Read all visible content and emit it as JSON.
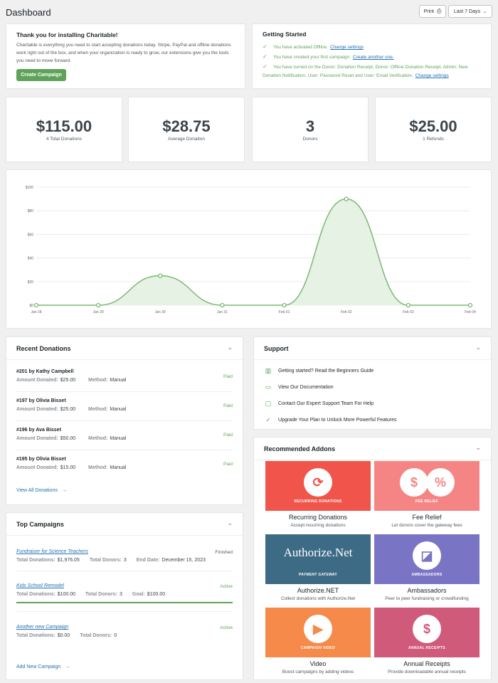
{
  "header": {
    "title": "Dashboard",
    "print_label": "Print",
    "date_range": "Last 7 Days"
  },
  "welcome": {
    "title": "Thank you for installing Charitable!",
    "body": "Charitable is everything you need to start accepting donations today. Stripe, PayPal and offline donations work right out of the box, and when your organization is ready to grow, our extensions give you the tools you need to move forward.",
    "button": "Create Campaign"
  },
  "getting_started": {
    "title": "Getting Started",
    "items": [
      {
        "text": "You have activated Offline.",
        "link": "Change settings"
      },
      {
        "text": "You have created your first campaign.",
        "link": "Create another one."
      },
      {
        "text": "You have turned on the Donor: Donation Receipt, Donor: Offline Donation Receipt, Admin: New Donation Notification, User: Password Reset and User: Email Verification.",
        "link": "Change settings"
      }
    ]
  },
  "stats": [
    {
      "value": "$115.00",
      "label": "4 Total Donations"
    },
    {
      "value": "$28.75",
      "label": "Average Donation"
    },
    {
      "value": "3",
      "label": "Donors"
    },
    {
      "value": "$25.00",
      "label": "1 Refunds"
    }
  ],
  "chart_data": {
    "type": "area",
    "x": [
      "Jan 28",
      "Jan 29",
      "Jan 30",
      "Jan 31",
      "Feb 01",
      "Feb 02",
      "Feb 03",
      "Feb 04"
    ],
    "series": [
      {
        "values": [
          0,
          0,
          25,
          0,
          0,
          90,
          0,
          0
        ]
      }
    ],
    "yticks": [
      "$0",
      "$20",
      "$40",
      "$60",
      "$80",
      "$100"
    ],
    "ylim": [
      0,
      100
    ],
    "grid": true,
    "colors": {
      "line": "#7bb874",
      "fill": "#e6f2e4"
    }
  },
  "recent_donations": {
    "title": "Recent Donations",
    "amount_label": "Amount Donated:",
    "method_label": "Method:",
    "rows": [
      {
        "name": "#201 by Kathy Campbell",
        "amount": "$25.00",
        "method": "Manual",
        "status": "Paid"
      },
      {
        "name": "#197 by Olivia Bisset",
        "amount": "$25.00",
        "method": "Manual",
        "status": "Paid"
      },
      {
        "name": "#196 by Ava Bisset",
        "amount": "$50.00",
        "method": "Manual",
        "status": "Paid"
      },
      {
        "name": "#195 by Olivia Bisset",
        "amount": "$15.00",
        "method": "Manual",
        "status": "Paid"
      }
    ],
    "view_all": "View All Donations"
  },
  "top_campaigns": {
    "title": "Top Campaigns",
    "rows": [
      {
        "name": "Fundraiser for Science Teachers",
        "status": "Finished",
        "status_color": "#50575e",
        "meta": [
          [
            "Total Donations:",
            "$1,976.05"
          ],
          [
            "Total Donors:",
            "3"
          ],
          [
            "End Date:",
            "December 15, 2023"
          ]
        ],
        "progress": null
      },
      {
        "name": "Kids School Remodel",
        "status": "Active",
        "status_color": "#5fa35a",
        "meta": [
          [
            "Total Donations:",
            "$100.00"
          ],
          [
            "Total Donors:",
            "3"
          ],
          [
            "Goal:",
            "$100.00"
          ]
        ],
        "progress": 1.0
      },
      {
        "name": "Another new Campaign",
        "status": "Active",
        "status_color": "#5fa35a",
        "meta": [
          [
            "Total Donations:",
            "$0.00"
          ],
          [
            "Total Donors:",
            "0"
          ]
        ],
        "progress": null
      }
    ],
    "add_new": "Add New Campaign"
  },
  "support": {
    "title": "Support",
    "items": [
      {
        "icon": "book-icon",
        "glyph": "▥",
        "label": "Getting started? Read the Beginners Guide"
      },
      {
        "icon": "document-icon",
        "glyph": "▭",
        "label": "View Our Documentation"
      },
      {
        "icon": "chat-icon",
        "glyph": "▢",
        "label": "Contact Our Expert Support Team For Help"
      },
      {
        "icon": "check-icon",
        "glyph": "✓",
        "label": "Upgrade Your Plan to Unlock More Powerful Features"
      }
    ]
  },
  "addons": {
    "title": "Recommended Addons",
    "items": [
      {
        "name": "Recurring Donations",
        "desc": "Accept recurring donations",
        "tile_label": "RECURRING DONATIONS",
        "color": "#f0544b",
        "icon": "refresh-icon",
        "glyph": "⟳"
      },
      {
        "name": "Fee Relief",
        "desc": "Let donors cover the gateway fees",
        "tile_label": "FEE RELIEF",
        "color": "#f58585",
        "icon": "dollar-percent-icon",
        "glyph": "$"
      },
      {
        "name": "Authorize.NET",
        "desc": "Collect donations with Authorize.Net",
        "tile_label": "PAYMENT GATEWAY",
        "color": "#3d6b86",
        "icon": "authorize-net-logo",
        "logo_text": "Authorize.Net"
      },
      {
        "name": "Ambassadors",
        "desc": "Peer to peer fundraising or crowdfunding",
        "tile_label": "AMBASSADORS",
        "color": "#7a74c4",
        "icon": "ambassadors-icon",
        "glyph": "◪"
      },
      {
        "name": "Video",
        "desc": "Boost campaigns by adding videos",
        "tile_label": "CAMPAIGN VIDEO",
        "color": "#f58a4a",
        "icon": "video-icon",
        "glyph": "▶"
      },
      {
        "name": "Annual Receipts",
        "desc": "Provide downloadable annual receipts",
        "tile_label": "ANNUAL RECEIPTS",
        "color": "#cf5a7a",
        "icon": "receipt-icon",
        "glyph": "$"
      }
    ]
  }
}
